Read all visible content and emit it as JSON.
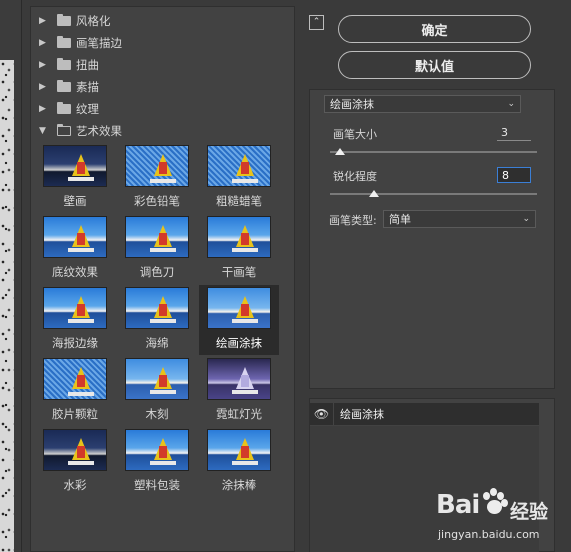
{
  "gallery": {
    "categories": [
      {
        "label": "风格化",
        "expanded": false
      },
      {
        "label": "画笔描边",
        "expanded": false
      },
      {
        "label": "扭曲",
        "expanded": false
      },
      {
        "label": "素描",
        "expanded": false
      },
      {
        "label": "纹理",
        "expanded": false
      },
      {
        "label": "艺术效果",
        "expanded": true
      }
    ],
    "filters": [
      {
        "label": "壁画"
      },
      {
        "label": "彩色铅笔"
      },
      {
        "label": "粗糙蜡笔"
      },
      {
        "label": "底纹效果"
      },
      {
        "label": "调色刀"
      },
      {
        "label": "干画笔"
      },
      {
        "label": "海报边缘"
      },
      {
        "label": "海绵"
      },
      {
        "label": "绘画涂抹",
        "selected": true
      },
      {
        "label": "胶片颗粒"
      },
      {
        "label": "木刻"
      },
      {
        "label": "霓虹灯光"
      },
      {
        "label": "水彩"
      },
      {
        "label": "塑料包装"
      },
      {
        "label": "涂抹棒"
      }
    ]
  },
  "actions": {
    "collapse_glyph": "⌃",
    "ok_label": "确定",
    "default_label": "默认值"
  },
  "settings": {
    "filter_select": "绘画涂抹",
    "brush_size": {
      "label": "画笔大小",
      "value": "3"
    },
    "sharpness": {
      "label": "锐化程度",
      "value": "8"
    },
    "brush_type": {
      "label": "画笔类型:",
      "value": "简单"
    }
  },
  "layers": {
    "eye_glyph": "👁",
    "row_label": "绘画涂抹"
  },
  "watermark": {
    "logo": "Bai",
    "suffix": "经验",
    "url": "jingyan.baidu.com"
  },
  "colors": {
    "panel_bg": "#424242",
    "window_bg": "#3a3a3a",
    "focus_border": "#3b7fd6"
  }
}
